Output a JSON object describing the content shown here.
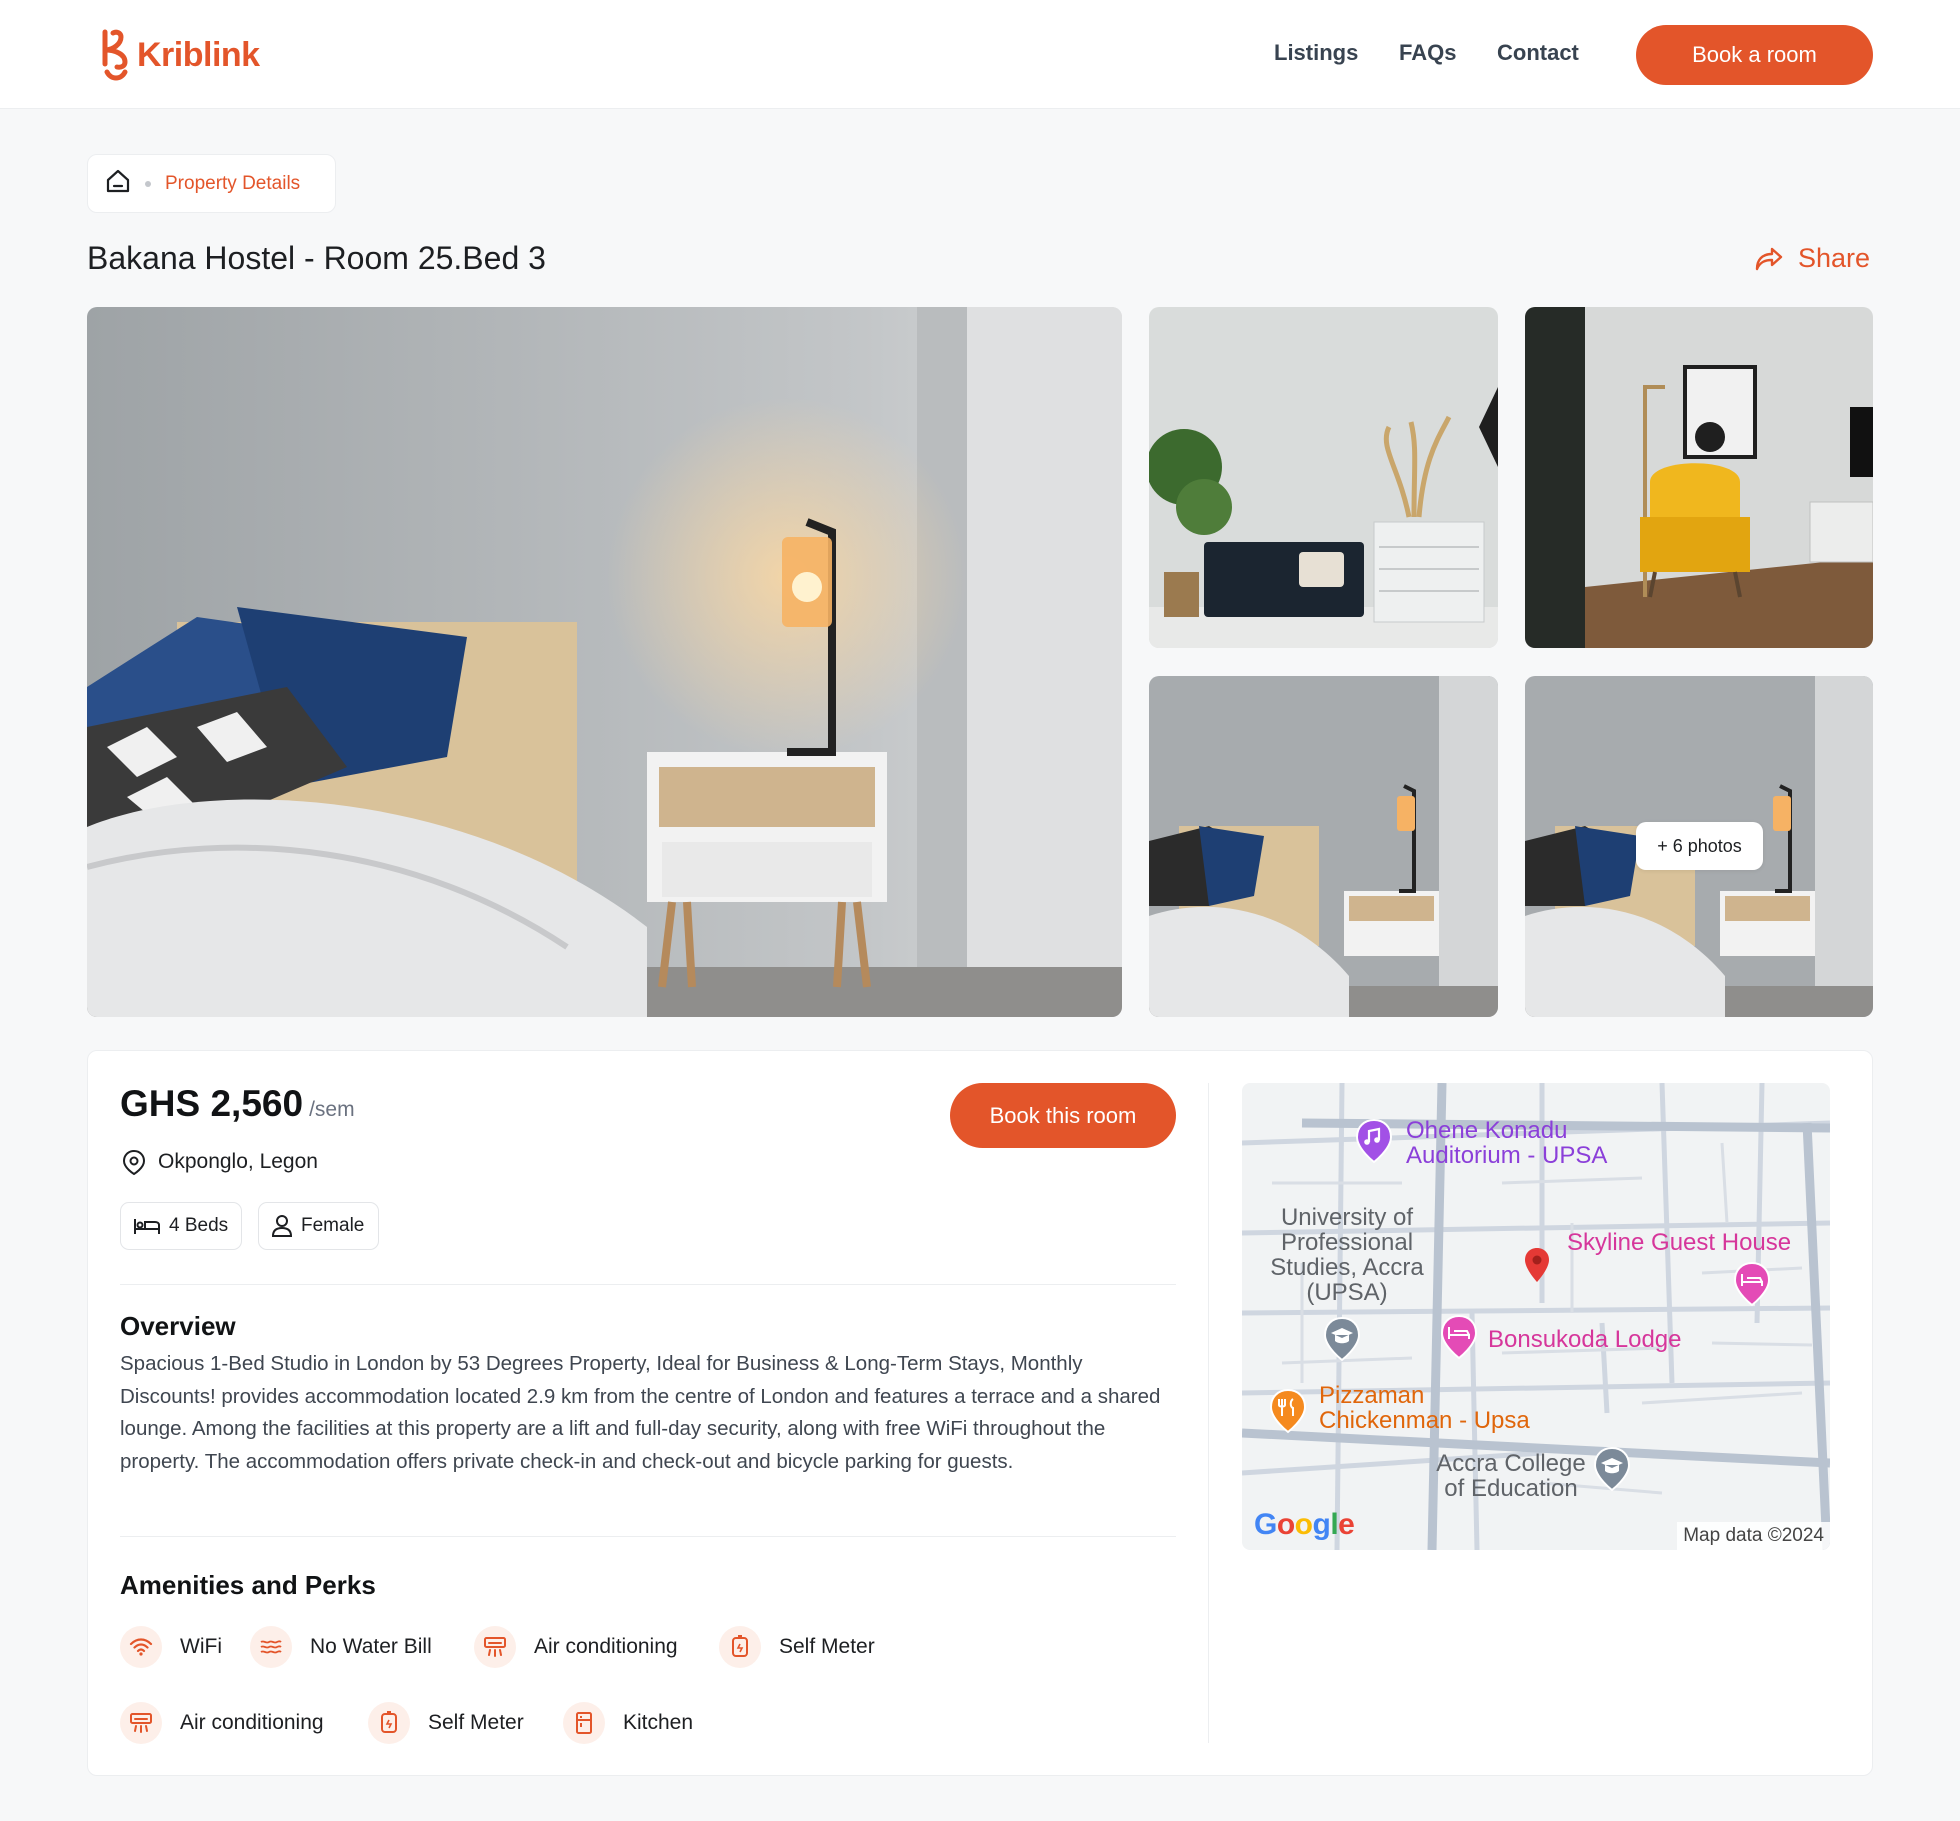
{
  "brand": {
    "name": "Kriblink",
    "color": "#e3552a"
  },
  "nav": {
    "links": [
      "Listings",
      "FAQs",
      "Contact"
    ],
    "cta": "Book a room"
  },
  "breadcrumb": {
    "home_icon": "home-icon",
    "current": "Property Details"
  },
  "property": {
    "title": "Bakana Hostel - Room 25.Bed 3",
    "share_label": "Share",
    "more_photos_label": "+ 6 photos",
    "price": "GHS 2,560",
    "price_unit": "/sem",
    "book_label": "Book this room",
    "location": "Okponglo, Legon",
    "beds": "4 Beds",
    "gender": "Female"
  },
  "overview": {
    "heading": "Overview",
    "text": "Spacious 1-Bed Studio in London by 53 Degrees Property, Ideal for Business & Long-Term Stays, Monthly Discounts! provides accommodation located 2.9 km from the centre of London and features a terrace and a shared lounge. Among the facilities at this property are a lift and full-day security, along with free WiFi throughout the property. The accommodation offers private check-in and check-out and bicycle parking for guests."
  },
  "amenities": {
    "heading": "Amenities and Perks",
    "items": [
      {
        "label": "WiFi",
        "icon": "wifi-icon"
      },
      {
        "label": "No Water Bill",
        "icon": "water-icon"
      },
      {
        "label": "Air conditioning",
        "icon": "air-conditioner-icon"
      },
      {
        "label": "Self Meter",
        "icon": "meter-icon"
      },
      {
        "label": "Air conditioning",
        "icon": "air-conditioner-icon"
      },
      {
        "label": "Self Meter",
        "icon": "meter-icon"
      },
      {
        "label": "Kitchen",
        "icon": "kitchen-icon"
      }
    ]
  },
  "map": {
    "places": [
      "Ohene Konadu\nAuditorium - UPSA",
      "University of\nProfessional\nStudies, Accra\n(UPSA)",
      "Skyline Guest House",
      "Bonsukoda Lodge",
      "Pizzaman\nChickenman - Upsa",
      "Accra College\nof Education"
    ],
    "attribution": "Map data ©2024",
    "provider": "Google"
  }
}
